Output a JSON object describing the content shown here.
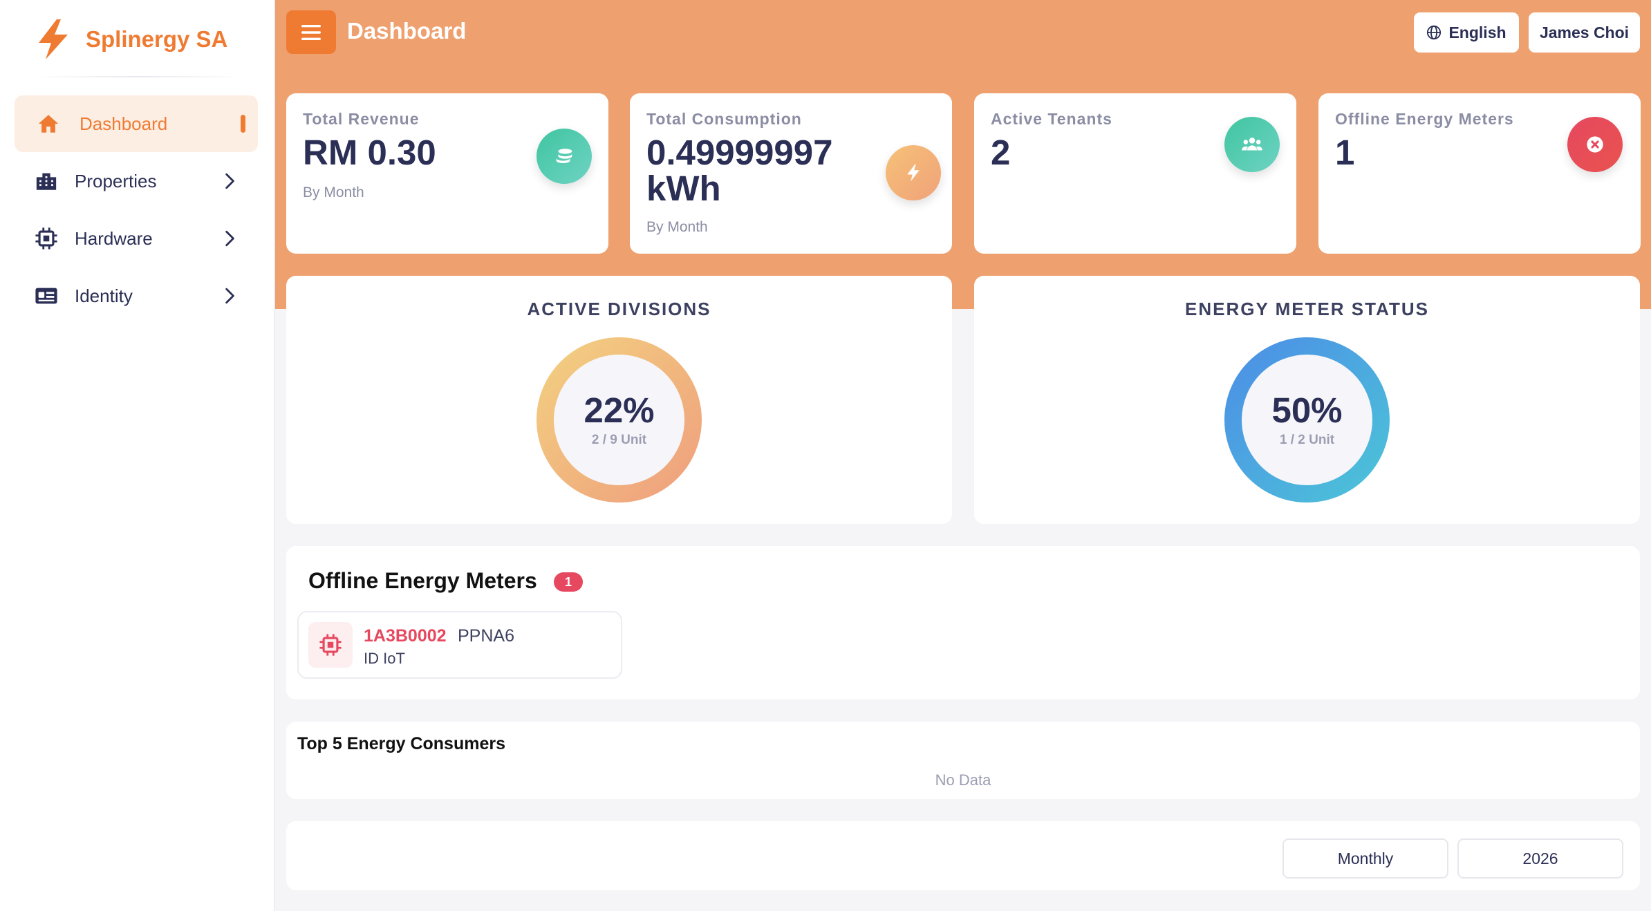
{
  "brand": {
    "name": "Splinergy SA",
    "color": "#ef7b32"
  },
  "sidebar": {
    "items": [
      {
        "label": "Dashboard",
        "icon": "home-icon",
        "active": true
      },
      {
        "label": "Properties",
        "icon": "building-icon"
      },
      {
        "label": "Hardware",
        "icon": "chip-icon"
      },
      {
        "label": "Identity",
        "icon": "id-card-icon"
      }
    ]
  },
  "header": {
    "title": "Dashboard",
    "language_label": "English",
    "user_label": "James Choi"
  },
  "stats": [
    {
      "label": "Total Revenue",
      "value": "RM 0.30",
      "sub": "By Month",
      "icon": "coins-icon"
    },
    {
      "label": "Total Consumption",
      "value": "0.49999997 kWh",
      "sub": "By Month",
      "icon": "bolt-icon"
    },
    {
      "label": "Active Tenants",
      "value": "2",
      "icon": "users-icon"
    },
    {
      "label": "Offline Energy Meters",
      "value": "1",
      "icon": "close-circle-icon"
    }
  ],
  "active_divisions": {
    "title": "ACTIVE DIVISIONS",
    "percent": "22%",
    "unit_text": "2 / 9 Unit",
    "fraction": 0.22
  },
  "meter_status": {
    "title": "ENERGY METER STATUS",
    "percent": "50%",
    "unit_text": "1 / 2 Unit",
    "fraction": 0.5
  },
  "offline_meters": {
    "title": "Offline Energy Meters",
    "count": "1",
    "items": [
      {
        "id": "1A3B0002",
        "name": "PPNA6",
        "sub": "ID IoT"
      }
    ]
  },
  "top_consumers": {
    "title": "Top 5 Energy Consumers",
    "empty_text": "No Data"
  },
  "filters": {
    "period": "Monthly",
    "year": "2026"
  },
  "colors": {
    "accent": "#ef7b32",
    "hero_bg": "#eea06f",
    "danger": "#e6485f",
    "text_dark": "#2b2f55"
  }
}
